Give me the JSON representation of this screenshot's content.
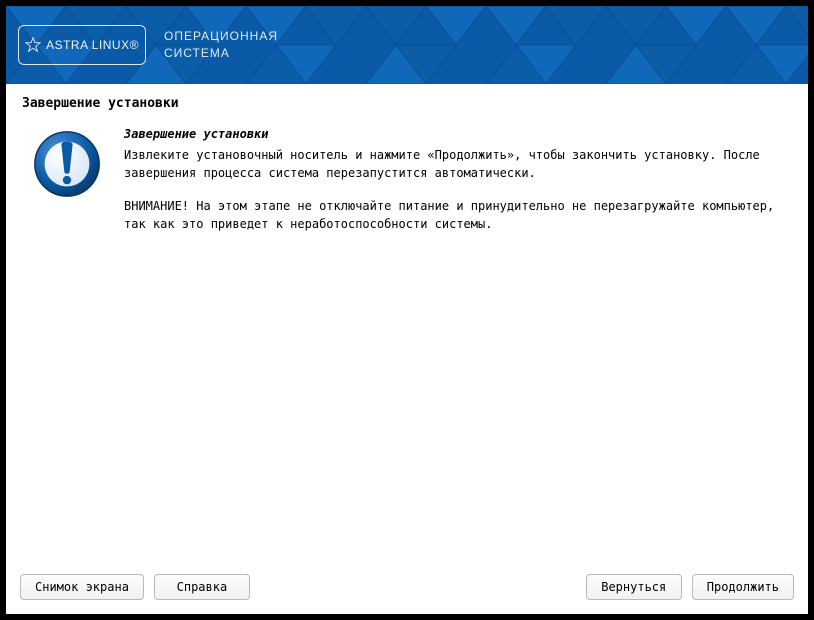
{
  "header": {
    "logo_text": "ASTRA LINUX®",
    "subtitle_line1": "ОПЕРАЦИОННАЯ",
    "subtitle_line2": "СИСТЕМА"
  },
  "page": {
    "title": "Завершение установки",
    "subheading": "Завершение установки",
    "paragraph1": "Извлеките установочный носитель и нажмите «Продолжить», чтобы закончить установку. После завершения процесса система перезапустится автоматически.",
    "paragraph2": "ВНИМАНИЕ! На этом этапе не отключайте питание и принудительно не перезагружайте компьютер, так как это приведет к неработоспособности системы."
  },
  "footer": {
    "screenshot": "Снимок экрана",
    "help": "Справка",
    "back": "Вернуться",
    "continue": "Продолжить"
  }
}
